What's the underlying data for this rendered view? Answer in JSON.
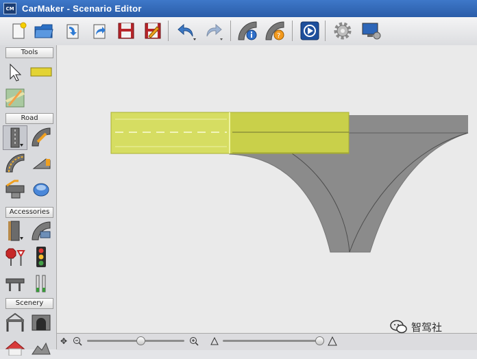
{
  "window": {
    "badge": "CM",
    "title": "CarMaker - Scenario Editor"
  },
  "toolbar": {
    "buttons": [
      "new-file",
      "open-folder",
      "import",
      "export",
      "save",
      "save-as",
      "undo",
      "redo",
      "road-info",
      "road-help",
      "play",
      "settings",
      "display"
    ]
  },
  "sidebar": {
    "sections": [
      {
        "label": "Tools"
      },
      {
        "label": "Road"
      },
      {
        "label": "Accessories"
      },
      {
        "label": "Scenery"
      }
    ]
  },
  "canvas": {
    "selection_color": "#d6dd62",
    "road_color": "#8b8b8b",
    "background_color": "#eaeaea"
  },
  "bottombar": {
    "zoom_level": 0.55,
    "height_level": 0.95
  },
  "watermark": {
    "text": "智驾社"
  }
}
